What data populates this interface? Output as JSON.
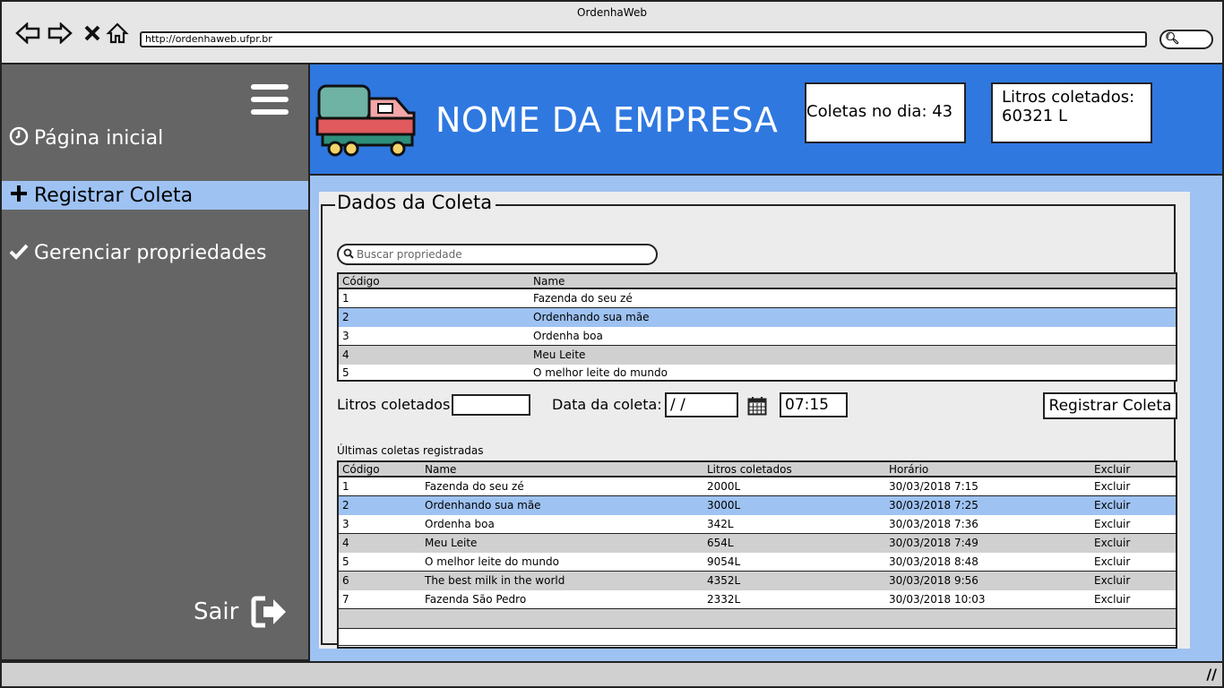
{
  "browser": {
    "window_title": "OrdenhaWeb",
    "url": "http://ordenhaweb.ufpr.br",
    "icons": [
      "back-icon",
      "forward-icon",
      "stop-icon",
      "home-icon",
      "search-icon"
    ]
  },
  "sidebar": {
    "items": [
      {
        "label": "Página inicial",
        "icon": "clock-icon"
      },
      {
        "label": "Registrar Coleta",
        "icon": "plus-icon"
      },
      {
        "label": "Gerenciar propriedades",
        "icon": "check-icon"
      }
    ],
    "logout_label": "Sair"
  },
  "header": {
    "company_name": "NOME DA EMPRESA",
    "stat_collections": "Coletas no dia: 43",
    "stat_liters_label": "Litros coletados:",
    "stat_liters_value": "60321 L"
  },
  "form": {
    "legend": "Dados da Coleta",
    "search_placeholder": "Buscar propriedade",
    "properties_table": {
      "headers": [
        "Código",
        "Name"
      ],
      "rows": [
        [
          "1",
          "Fazenda do seu zé"
        ],
        [
          "2",
          "Ordenhando sua mãe"
        ],
        [
          "3",
          "Ordenha boa"
        ],
        [
          "4",
          "Meu Leite"
        ],
        [
          "5",
          "O melhor leite do mundo"
        ]
      ],
      "selected_row": 2
    },
    "liters_label": "Litros coletados:",
    "liters_value": "",
    "date_label": "Data da coleta:",
    "date_value": " /  /",
    "time_value": "07:15",
    "register_button": "Registrar Coleta",
    "recent_title": "Últimas coletas registradas",
    "recent_table": {
      "headers": [
        "Código",
        "Name",
        "Litros coletados",
        "Horário",
        "Excluir"
      ],
      "rows": [
        [
          "1",
          "Fazenda do seu zé",
          "2000L",
          "30/03/2018 7:15",
          "Excluir"
        ],
        [
          "2",
          "Ordenhando sua mãe",
          "3000L",
          "30/03/2018 7:25",
          "Excluir"
        ],
        [
          "3",
          "Ordenha boa",
          "342L",
          "30/03/2018 7:36",
          "Excluir"
        ],
        [
          "4",
          "Meu Leite",
          "654L",
          "30/03/2018 7:49",
          "Excluir"
        ],
        [
          "5",
          "O melhor leite do mundo",
          "9054L",
          "30/03/2018 8:48",
          "Excluir"
        ],
        [
          "6",
          "The best milk in the world",
          "4352L",
          "30/03/2018 9:56",
          "Excluir"
        ],
        [
          "7",
          "Fazenda São Pedro",
          "2332L",
          "30/03/2018 10:03",
          "Excluir"
        ]
      ],
      "selected_row": 2
    }
  },
  "colors": {
    "header_blue": "#2f78e0",
    "sidebar_gray": "#656565",
    "selection_blue": "#9ec2f2"
  }
}
